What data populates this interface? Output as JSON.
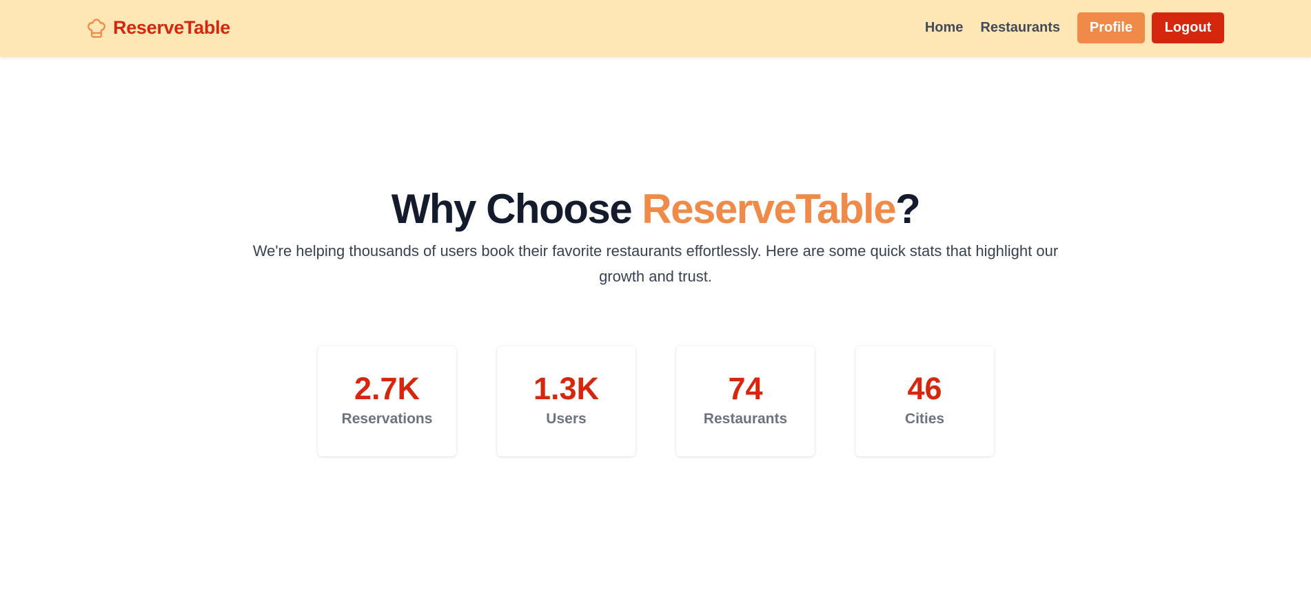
{
  "nav": {
    "brand": "ReserveTable",
    "brand_icon": "chef-hat-icon",
    "links": [
      "Home",
      "Restaurants"
    ],
    "profile_label": "Profile",
    "logout_label": "Logout"
  },
  "hero": {
    "title_prefix": "Why Choose ",
    "title_accent": "ReserveTable",
    "title_suffix": "?",
    "subtitle": "We're helping thousands of users book their favorite restaurants effortlessly. Here are some quick stats that highlight our growth and trust."
  },
  "stats": [
    {
      "value": "2.7K",
      "label": "Reservations"
    },
    {
      "value": "1.3K",
      "label": "Users"
    },
    {
      "value": "74",
      "label": "Restaurants"
    },
    {
      "value": "46",
      "label": "Cities"
    }
  ],
  "colors": {
    "nav_bg": "#fee6b5",
    "brand_red": "#d7260e",
    "accent_orange": "#ef8a48",
    "heading": "#141b2c",
    "body_text": "#374151",
    "muted": "#6b7280"
  }
}
